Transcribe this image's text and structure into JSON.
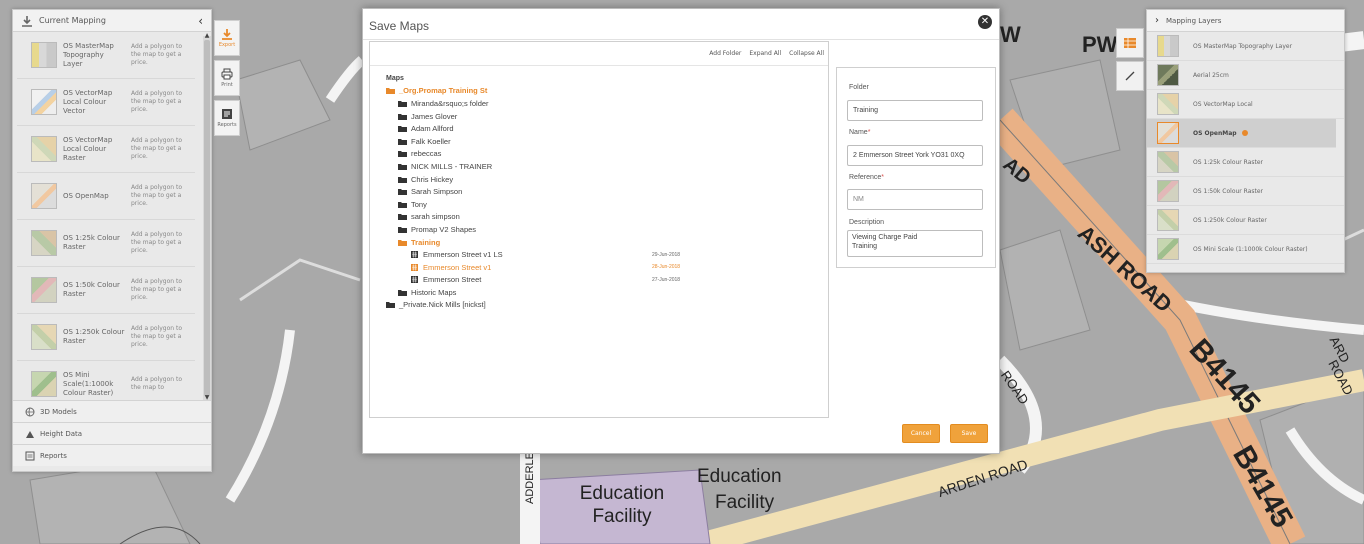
{
  "colors": {
    "accent": "#e8892b",
    "button": "#f0a23b",
    "road": "#e9b186",
    "map_bg": "#a9a9a9"
  },
  "map": {
    "labels": [
      "PW",
      "ASH ROAD",
      "B4145",
      "ARDEN ROAD",
      "Education Facility",
      "Education",
      "Facility",
      "ROAD",
      "ADDERLE",
      "AD",
      "W",
      "ARD",
      "ROAD"
    ]
  },
  "current_mapping": {
    "title": "Current Mapping",
    "collapse_icon": "chevron-left-icon",
    "layers": [
      {
        "name": "OS MasterMap Topography Layer",
        "note": "Add a polygon to the map to get a price."
      },
      {
        "name": "OS VectorMap Local Colour Vector",
        "note": "Add a polygon to the map to get a price."
      },
      {
        "name": "OS VectorMap Local Colour Raster",
        "note": "Add a polygon to the map to get a price."
      },
      {
        "name": "OS OpenMap",
        "note": "Add a polygon to the map to get a price."
      },
      {
        "name": "OS 1:25k Colour Raster",
        "note": "Add a polygon to the map to get a price."
      },
      {
        "name": "OS 1:50k Colour Raster",
        "note": "Add a polygon to the map to get a price."
      },
      {
        "name": "OS 1:250k Colour Raster",
        "note": "Add a polygon to the map to get a price."
      },
      {
        "name": "OS Mini Scale(1:1000k Colour Raster)",
        "note": "Add a polygon to the map to"
      }
    ],
    "sections": [
      "3D Models",
      "Height Data",
      "Reports"
    ]
  },
  "toolbar": {
    "export": "Export",
    "print": "Print",
    "reports": "Reports"
  },
  "mapping_layers": {
    "title": "Mapping Layers",
    "items": [
      {
        "label": "OS MasterMap Topography Layer",
        "active": false
      },
      {
        "label": "Aerial 25cm",
        "active": false
      },
      {
        "label": "OS VectorMap Local",
        "active": false
      },
      {
        "label": "OS OpenMap",
        "active": true
      },
      {
        "label": "OS 1:25k Colour Raster",
        "active": false
      },
      {
        "label": "OS 1:50k Colour Raster",
        "active": false
      },
      {
        "label": "OS 1:250k Colour Raster",
        "active": false
      },
      {
        "label": "OS Mini Scale (1:1000k Colour Raster)",
        "active": false
      }
    ]
  },
  "modal": {
    "title": "Save Maps",
    "tree_actions": [
      "Add Folder",
      "Expand All",
      "Collapse All"
    ],
    "tree": [
      {
        "label": "Maps",
        "level": 0,
        "kind": "root",
        "date": ""
      },
      {
        "label": "_Org.Promap Training St",
        "level": 0,
        "kind": "folder-open",
        "date": ""
      },
      {
        "label": "Miranda&rsquo;s folder",
        "level": 1,
        "kind": "folder",
        "date": ""
      },
      {
        "label": "James Glover",
        "level": 1,
        "kind": "folder",
        "date": ""
      },
      {
        "label": "Adam Allford",
        "level": 1,
        "kind": "folder",
        "date": ""
      },
      {
        "label": "Falk Koeller",
        "level": 1,
        "kind": "folder",
        "date": ""
      },
      {
        "label": "rebeccas",
        "level": 1,
        "kind": "folder",
        "date": ""
      },
      {
        "label": "NICK MILLS - TRAINER",
        "level": 1,
        "kind": "folder",
        "date": ""
      },
      {
        "label": "Chris Hickey",
        "level": 1,
        "kind": "folder",
        "date": ""
      },
      {
        "label": "Sarah Simpson",
        "level": 1,
        "kind": "folder",
        "date": ""
      },
      {
        "label": "Tony",
        "level": 1,
        "kind": "folder",
        "date": ""
      },
      {
        "label": "sarah simpson",
        "level": 1,
        "kind": "folder",
        "date": ""
      },
      {
        "label": "Promap V2 Shapes",
        "level": 1,
        "kind": "folder",
        "date": ""
      },
      {
        "label": "Training",
        "level": 1,
        "kind": "folder-open",
        "date": ""
      },
      {
        "label": "Emmerson Street v1 LS",
        "level": 2,
        "kind": "map",
        "date": "29-Jun-2018"
      },
      {
        "label": "Emmerson Street v1",
        "level": 2,
        "kind": "map-selected",
        "date": "28-Jun-2018"
      },
      {
        "label": "Emmerson Street",
        "level": 2,
        "kind": "map",
        "date": "27-Jun-2018"
      },
      {
        "label": "Historic Maps",
        "level": 1,
        "kind": "folder",
        "date": ""
      },
      {
        "label": "_Private.Nick Mills [nickst]",
        "level": 0,
        "kind": "folder",
        "date": ""
      }
    ],
    "form": {
      "folder_label": "Folder",
      "folder_value": "Training",
      "name_label": "Name",
      "name_value": "2 Emmerson Street York YO31 0XQ",
      "reference_label": "Reference",
      "reference_placeholder": "NM",
      "description_label": "Description",
      "description_value": "Viewing Charge Paid\nTraining",
      "required_mark": "*"
    },
    "cancel": "Cancel",
    "save": "Save"
  }
}
